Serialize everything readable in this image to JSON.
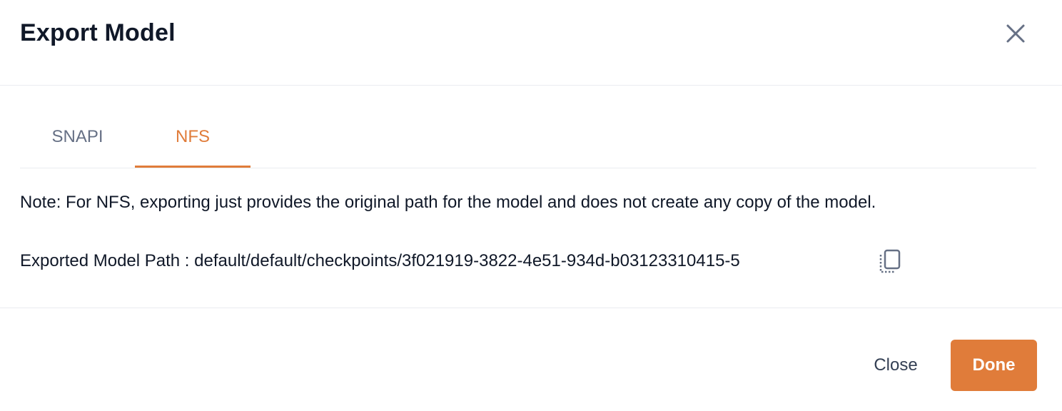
{
  "dialog": {
    "title": "Export Model",
    "close_icon": "close-icon"
  },
  "tabs": [
    {
      "label": "SNAPI",
      "active": false
    },
    {
      "label": "NFS",
      "active": true
    }
  ],
  "note": "Note: For NFS, exporting just provides the original path for the model and does not create any copy of the model.",
  "path": {
    "label": "Exported Model Path :",
    "value": "default/default/checkpoints/3f021919-3822-4e51-934d-b03123310415-5",
    "copy_icon": "copy-icon"
  },
  "footer": {
    "close_label": "Close",
    "done_label": "Done"
  },
  "colors": {
    "accent": "#e07c3a",
    "text": "#101828",
    "muted": "#667085",
    "divider": "#eaecf0"
  }
}
